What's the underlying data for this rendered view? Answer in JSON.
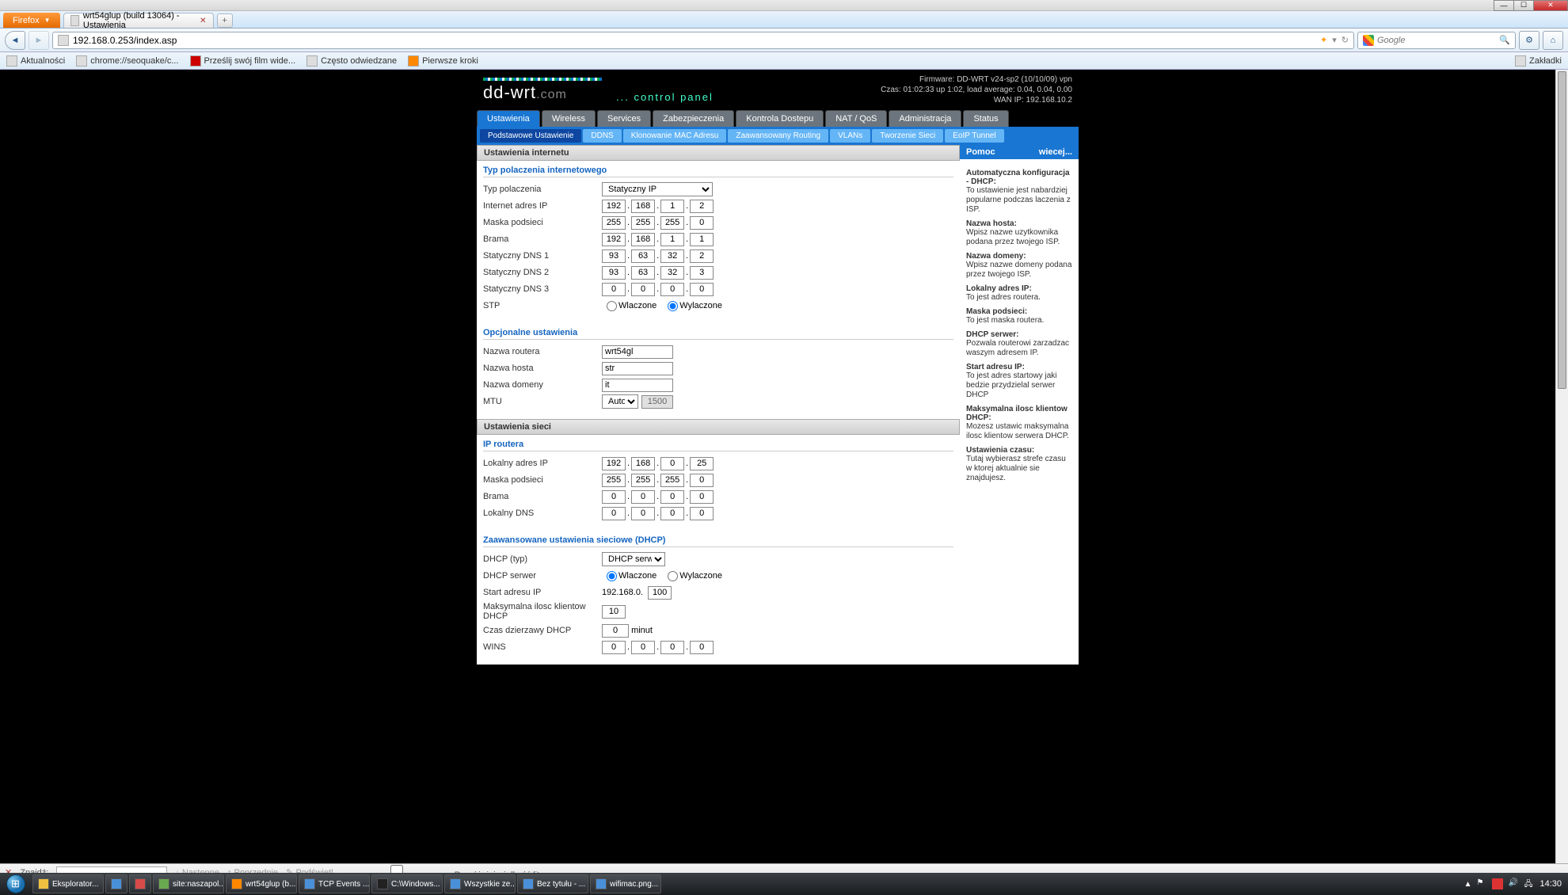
{
  "chrome": {
    "firefox_menu": "Firefox",
    "tab_title": "wrt54glup (build 13064) - Ustawienia",
    "url": "192.168.0.253/index.asp",
    "search_placeholder": "Google",
    "bookmarks": {
      "b1": "Aktualności",
      "b2": "chrome://seoquake/c...",
      "b3": "Prześlij swój film wide...",
      "b4": "Często odwiedzane",
      "b5": "Pierwsze kroki",
      "right": "Zakładki"
    }
  },
  "ddwrt": {
    "logo_main": "dd-wrt",
    "logo_suffix": ".com",
    "control_panel": "... control panel",
    "status1": "Firmware: DD-WRT v24-sp2 (10/10/09) vpn",
    "status2": "Czas: 01:02:33 up 1:02, load average: 0.04, 0.04, 0.00",
    "status3": "WAN IP: 192.168.10.2",
    "tabs": {
      "t1": "Ustawienia",
      "t2": "Wireless",
      "t3": "Services",
      "t4": "Zabezpieczenia",
      "t5": "Kontrola Dostepu",
      "t6": "NAT / QoS",
      "t7": "Administracja",
      "t8": "Status"
    },
    "subtabs": {
      "s1": "Podstawowe Ustawienie",
      "s2": "DDNS",
      "s3": "Klonowanie MAC Adresu",
      "s4": "Zaawansowany Routing",
      "s5": "VLANs",
      "s6": "Tworzenie Sieci",
      "s7": "EoIP Tunnel"
    },
    "sect_internet": "Ustawienia internetu",
    "fs_conn": "Typ polaczenia internetowego",
    "labels": {
      "typ": "Typ polaczenia",
      "wanip": "Internet adres IP",
      "mask": "Maska podsieci",
      "gw": "Brama",
      "dns1": "Statyczny DNS 1",
      "dns2": "Statyczny DNS 2",
      "dns3": "Statyczny DNS 3",
      "stp": "STP",
      "on": "Wlaczone",
      "off": "Wylaczone",
      "wan_type_val": "Statyczny IP"
    },
    "ip": {
      "wan": [
        "192",
        "168",
        "1",
        "2"
      ],
      "mask": [
        "255",
        "255",
        "255",
        "0"
      ],
      "gw": [
        "192",
        "168",
        "1",
        "1"
      ],
      "dns1": [
        "93",
        "63",
        "32",
        "2"
      ],
      "dns2": [
        "93",
        "63",
        "32",
        "3"
      ],
      "dns3": [
        "0",
        "0",
        "0",
        "0"
      ]
    },
    "fs_opt": "Opcjonalne ustawienia",
    "opt": {
      "rname_l": "Nazwa routera",
      "rname": "wrt54gl",
      "hname_l": "Nazwa hosta",
      "hname": "str",
      "dname_l": "Nazwa domeny",
      "dname": "it",
      "mtu_l": "MTU",
      "mtu_mode": "Auto",
      "mtu_val": "1500"
    },
    "sect_net": "Ustawienia sieci",
    "fs_router": "IP routera",
    "router": {
      "lip_l": "Lokalny adres IP",
      "lip": [
        "192",
        "168",
        "0",
        "25"
      ],
      "mask_l": "Maska podsieci",
      "mask": [
        "255",
        "255",
        "255",
        "0"
      ],
      "gw_l": "Brama",
      "gw": [
        "0",
        "0",
        "0",
        "0"
      ],
      "ldns_l": "Lokalny DNS",
      "ldns": [
        "0",
        "0",
        "0",
        "0"
      ]
    },
    "fs_dhcp": "Zaawansowane ustawienia sieciowe (DHCP)",
    "dhcp": {
      "type_l": "DHCP (typ)",
      "type_v": "DHCP serwer",
      "srv_l": "DHCP serwer",
      "start_l": "Start adresu IP",
      "start_p": "192.168.0.",
      "start_v": "100",
      "max_l": "Maksymalna ilosc klientow DHCP",
      "max_v": "10",
      "lease_l": "Czas dzierzawy DHCP",
      "lease_v": "0",
      "lease_u": "minut",
      "wins_l": "WINS",
      "wins": [
        "0",
        "0",
        "0",
        "0"
      ]
    }
  },
  "help": {
    "title": "Pomoc",
    "more": "wiecej...",
    "h1": "Automatyczna konfiguracja - DHCP:",
    "p1": "To ustawienie jest nabardziej popularne podczas laczenia z ISP.",
    "h2": "Nazwa hosta:",
    "p2": "Wpisz nazwe uzytkownika podana przez twojego ISP.",
    "h3": "Nazwa domeny:",
    "p3": "Wpisz nazwe domeny podana przez twojego ISP.",
    "h4": "Lokalny adres IP:",
    "p4": "To jest adres routera.",
    "h5": "Maska podsieci:",
    "p5": "To jest maska routera.",
    "h6": "DHCP serwer:",
    "p6": "Pozwala routerowi zarzadzac waszym adresem IP.",
    "h7": "Start adresu IP:",
    "p7": "To jest adres startowy jaki bedzie przydzielal serwer DHCP",
    "h8": "Maksymalna ilosc klientow DHCP:",
    "p8": "Mozesz ustawic maksymalna ilosc klientow serwera DHCP.",
    "h9": "Ustawienia czasu:",
    "p9": "Tutaj wybierasz strefe czasu w ktorej aktualnie sie znajdujesz."
  },
  "findbar": {
    "label": "Znajdź:",
    "next": "Następne",
    "prev": "Poprzednie",
    "hl": "Podświetl",
    "case": "Rozróżniaj wielkość liter"
  },
  "taskbar": {
    "items": [
      "Eksplorator...",
      "",
      "",
      "site:naszapol...",
      "wrt54glup (b...",
      "TCP Events ...",
      "C:\\Windows...",
      "Wszystkie ze...",
      "Bez tytułu - ...",
      "wifimac.png..."
    ],
    "clock": "14:30"
  }
}
